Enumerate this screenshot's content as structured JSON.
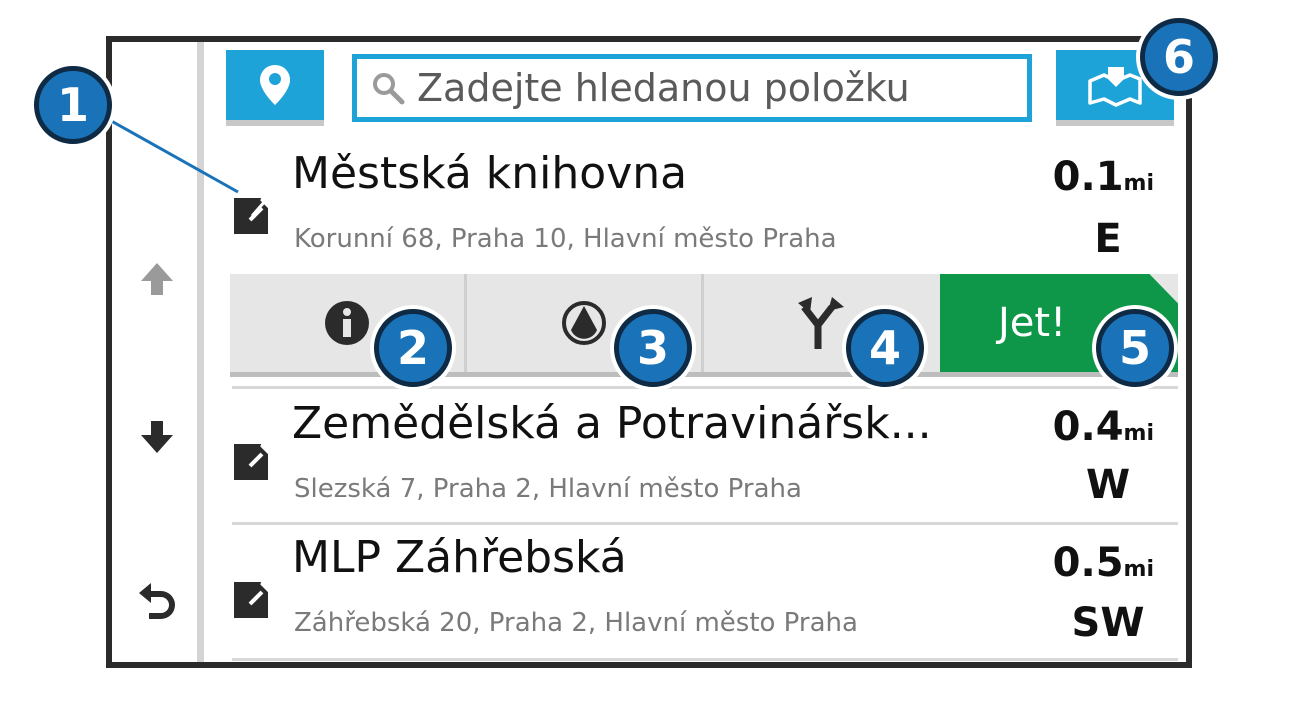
{
  "search": {
    "placeholder": "Zadejte hledanou položku"
  },
  "results": [
    {
      "name": "Městská knihovna",
      "address": "Korunní 68, Praha 10, Hlavní město Praha",
      "distance": "0.1",
      "unit": "mi",
      "direction": "E"
    },
    {
      "name": "Zemědělská a Potravinářsk...",
      "address": "Slezská 7, Praha 2, Hlavní město Praha",
      "distance": "0.4",
      "unit": "mi",
      "direction": "W"
    },
    {
      "name": "MLP Záhřebská",
      "address": "Záhřebská 20, Praha 2, Hlavní město Praha",
      "distance": "0.5",
      "unit": "mi",
      "direction": "SW"
    }
  ],
  "actions": {
    "go_label": "Jet!"
  },
  "callouts": [
    "1",
    "2",
    "3",
    "4",
    "5",
    "6"
  ],
  "colors": {
    "accent": "#1ea3d8",
    "go": "#0e9748",
    "callout": "#1a73b8"
  },
  "icons": {
    "location": "map-pin-icon",
    "search": "magnifier-icon",
    "map": "folded-map-icon",
    "up": "arrow-up-icon",
    "down": "arrow-down-icon",
    "back": "back-arrow-icon",
    "info": "info-icon",
    "compass": "circle-drop-icon",
    "route": "fork-route-icon",
    "poi": "pushpin-icon"
  }
}
